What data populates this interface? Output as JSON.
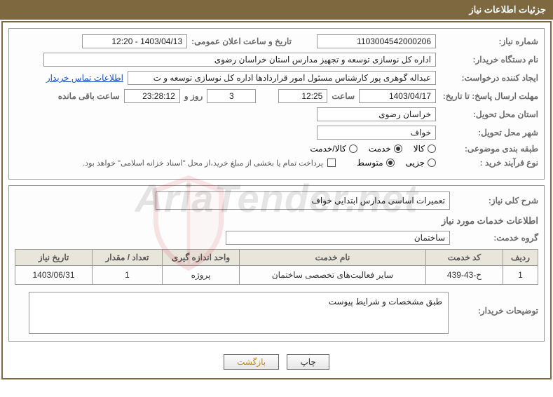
{
  "title": "جزئیات اطلاعات نیاز",
  "labels": {
    "need_number": "شماره نیاز:",
    "announce_datetime": "تاریخ و ساعت اعلان عمومی:",
    "buyer_org": "نام دستگاه خریدار:",
    "requester": "ایجاد کننده درخواست:",
    "contact_link": "اطلاعات تماس خریدار",
    "reply_deadline": "مهلت ارسال پاسخ: تا تاریخ:",
    "time_word": "ساعت",
    "days_and": "روز و",
    "remaining": "ساعت باقی مانده",
    "delivery_province": "استان محل تحویل:",
    "delivery_city": "شهر محل تحویل:",
    "subject_class": "طبقه بندی موضوعی:",
    "process_type": "نوع فرآیند خرید :",
    "payment_note": "پرداخت تمام یا بخشی از مبلغ خرید،از محل \"اسناد خزانه اسلامی\" خواهد بود.",
    "need_summary": "شرح کلی نیاز:",
    "services_info": "اطلاعات خدمات مورد نیاز",
    "service_group": "گروه خدمت:",
    "buyer_notes": "توضیحات خریدار:"
  },
  "fields": {
    "need_number": "1103004542000206",
    "announce_datetime": "1403/04/13 - 12:20",
    "buyer_org": "اداره کل نوسازی  توسعه و تجهیز مدارس استان خراسان رضوی",
    "requester": "عبداله گوهری پور کارشناس مسئول امور قراردادها  اداره کل نوسازی  توسعه و ت",
    "deadline_date": "1403/04/17",
    "deadline_time": "12:25",
    "days_left": "3",
    "time_left": "23:28:12",
    "province": "خراسان رضوی",
    "city": "خواف",
    "need_summary": "تعمیرات اساسی مدارس ابتدایی خواف",
    "service_group": "ساختمان",
    "buyer_notes": "طبق مشخصات و شرایط پیوست"
  },
  "radios": {
    "class_goods": "کالا",
    "class_service": "خدمت",
    "class_goods_service": "کالا/خدمت",
    "proc_minor": "جزیی",
    "proc_medium": "متوسط"
  },
  "table": {
    "headers": {
      "row": "ردیف",
      "code": "کد خدمت",
      "name": "نام خدمت",
      "unit": "واحد اندازه گیری",
      "qty": "تعداد / مقدار",
      "date": "تاریخ نیاز"
    },
    "rows": [
      {
        "row": "1",
        "code": "خ-43-439",
        "name": "سایر فعالیت‌های تخصصی ساختمان",
        "unit": "پروژه",
        "qty": "1",
        "date": "1403/06/31"
      }
    ]
  },
  "buttons": {
    "print": "چاپ",
    "back": "بازگشت"
  },
  "watermark": "AriaTender.net"
}
